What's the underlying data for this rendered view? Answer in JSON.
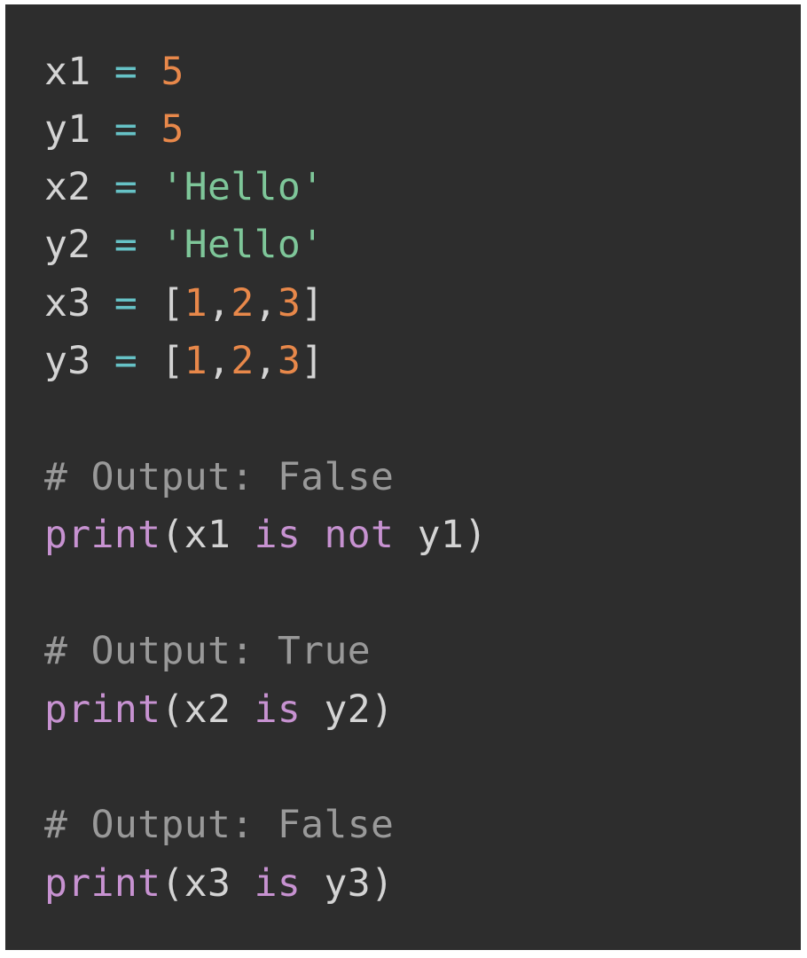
{
  "code": {
    "lines": [
      [
        {
          "t": "x1",
          "c": "var"
        },
        {
          "t": " ",
          "c": "var"
        },
        {
          "t": "=",
          "c": "op"
        },
        {
          "t": " ",
          "c": "var"
        },
        {
          "t": "5",
          "c": "num"
        }
      ],
      [
        {
          "t": "y1",
          "c": "var"
        },
        {
          "t": " ",
          "c": "var"
        },
        {
          "t": "=",
          "c": "op"
        },
        {
          "t": " ",
          "c": "var"
        },
        {
          "t": "5",
          "c": "num"
        }
      ],
      [
        {
          "t": "x2",
          "c": "var"
        },
        {
          "t": " ",
          "c": "var"
        },
        {
          "t": "=",
          "c": "op"
        },
        {
          "t": " ",
          "c": "var"
        },
        {
          "t": "'Hello'",
          "c": "str"
        }
      ],
      [
        {
          "t": "y2",
          "c": "var"
        },
        {
          "t": " ",
          "c": "var"
        },
        {
          "t": "=",
          "c": "op"
        },
        {
          "t": " ",
          "c": "var"
        },
        {
          "t": "'Hello'",
          "c": "str"
        }
      ],
      [
        {
          "t": "x3",
          "c": "var"
        },
        {
          "t": " ",
          "c": "var"
        },
        {
          "t": "=",
          "c": "op"
        },
        {
          "t": " ",
          "c": "var"
        },
        {
          "t": "[",
          "c": "punc"
        },
        {
          "t": "1",
          "c": "num"
        },
        {
          "t": ",",
          "c": "punc"
        },
        {
          "t": "2",
          "c": "num"
        },
        {
          "t": ",",
          "c": "punc"
        },
        {
          "t": "3",
          "c": "num"
        },
        {
          "t": "]",
          "c": "punc"
        }
      ],
      [
        {
          "t": "y3",
          "c": "var"
        },
        {
          "t": " ",
          "c": "var"
        },
        {
          "t": "=",
          "c": "op"
        },
        {
          "t": " ",
          "c": "var"
        },
        {
          "t": "[",
          "c": "punc"
        },
        {
          "t": "1",
          "c": "num"
        },
        {
          "t": ",",
          "c": "punc"
        },
        {
          "t": "2",
          "c": "num"
        },
        {
          "t": ",",
          "c": "punc"
        },
        {
          "t": "3",
          "c": "num"
        },
        {
          "t": "]",
          "c": "punc"
        }
      ],
      [
        {
          "t": "# Output: False",
          "c": "cmt"
        }
      ],
      [
        {
          "t": "print",
          "c": "kw"
        },
        {
          "t": "(x1 ",
          "c": "var"
        },
        {
          "t": "is",
          "c": "kw"
        },
        {
          "t": " ",
          "c": "var"
        },
        {
          "t": "not",
          "c": "kw"
        },
        {
          "t": " y1)",
          "c": "var"
        }
      ],
      [
        {
          "t": "# Output: True",
          "c": "cmt"
        }
      ],
      [
        {
          "t": "print",
          "c": "kw"
        },
        {
          "t": "(x2 ",
          "c": "var"
        },
        {
          "t": "is",
          "c": "kw"
        },
        {
          "t": " y2)",
          "c": "var"
        }
      ],
      [
        {
          "t": "# Output: False",
          "c": "cmt"
        }
      ],
      [
        {
          "t": "print",
          "c": "kw"
        },
        {
          "t": "(x3 ",
          "c": "var"
        },
        {
          "t": "is",
          "c": "kw"
        },
        {
          "t": " y3)",
          "c": "var"
        }
      ]
    ]
  },
  "theme": {
    "background": "#2d2d2d",
    "variable": "#d4d4d4",
    "operator": "#66c2c6",
    "number": "#e8884a",
    "string": "#7ec699",
    "keyword": "#c792d1",
    "comment": "#999999"
  }
}
